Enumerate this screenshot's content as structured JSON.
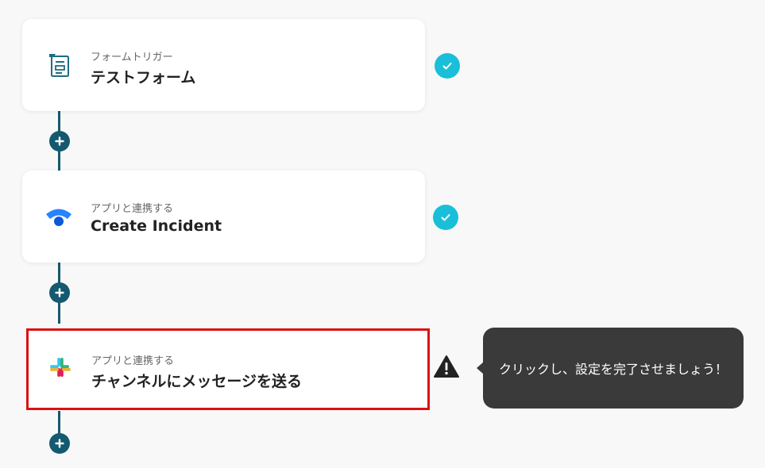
{
  "flow": {
    "steps": [
      {
        "subtitle": "フォームトリガー",
        "title": "テストフォーム",
        "icon": "form-icon",
        "status": "complete"
      },
      {
        "subtitle": "アプリと連携する",
        "title": "Create Incident",
        "icon": "statuspage-icon",
        "status": "complete"
      },
      {
        "subtitle": "アプリと連携する",
        "title": "チャンネルにメッセージを送る",
        "icon": "slack-icon",
        "status": "warning"
      }
    ]
  },
  "tooltip": {
    "text": "クリックし、設定を完了させましょう！"
  },
  "colors": {
    "connector": "#14596f",
    "check": "#19bfd9",
    "selected_border": "#dd1010",
    "tooltip_bg": "#3a3a3a"
  }
}
